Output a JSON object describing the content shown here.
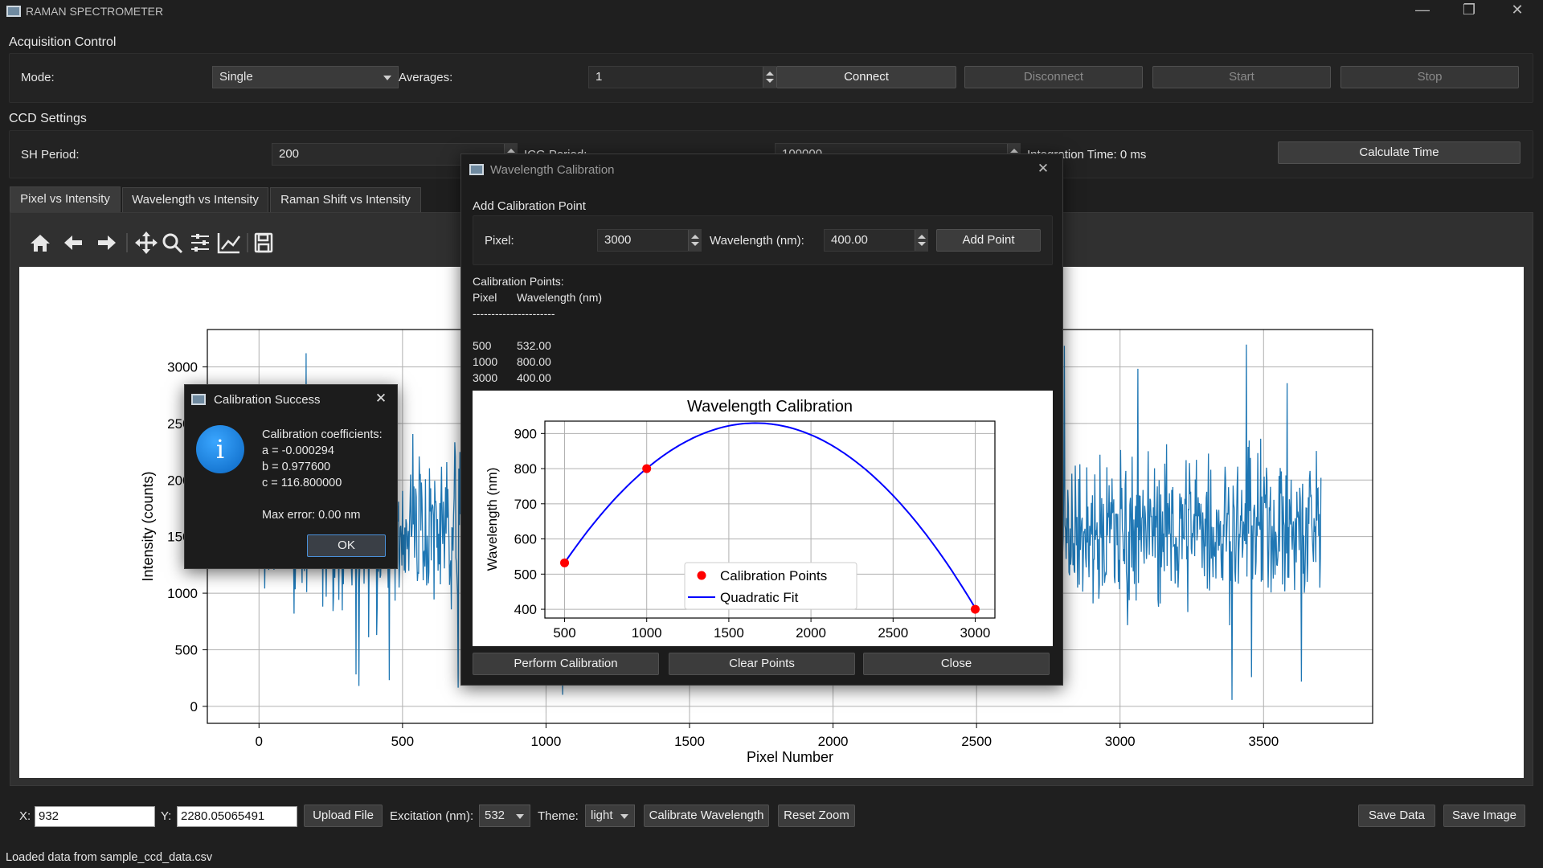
{
  "window": {
    "title": "RAMAN SPECTROMETER"
  },
  "acquisition": {
    "group_label": "Acquisition Control",
    "mode_label": "Mode:",
    "mode_value": "Single",
    "averages_label": "Averages:",
    "averages_value": "1",
    "connect": "Connect",
    "disconnect": "Disconnect",
    "start": "Start",
    "stop": "Stop"
  },
  "ccd": {
    "group_label": "CCD Settings",
    "sh_label": "SH Period:",
    "sh_value": "200",
    "icg_label": "ICG Period:",
    "icg_value": "100000",
    "integration": "Integration Time: 0 ms",
    "calc_button": "Calculate Time"
  },
  "tabs": [
    {
      "label": "Pixel vs Intensity",
      "active": true
    },
    {
      "label": "Wavelength vs Intensity",
      "active": false
    },
    {
      "label": "Raman Shift vs Intensity",
      "active": false
    }
  ],
  "toolbar": {
    "icons": [
      "home-icon",
      "back-arrow-icon",
      "forward-arrow-icon",
      "pan-icon",
      "zoom-icon",
      "subplots-config-icon",
      "axes-edit-icon",
      "save-icon"
    ]
  },
  "main_plot_labels": {
    "xlabel": "Pixel Number",
    "ylabel": "Intensity (counts)",
    "xticks": [
      "0",
      "500",
      "1000",
      "1500",
      "2000",
      "2500",
      "3000",
      "3500"
    ],
    "yticks": [
      "0",
      "500",
      "1000",
      "1500",
      "2000",
      "2500",
      "3000"
    ]
  },
  "calib_dialog": {
    "title": "Wavelength Calibration",
    "add_label": "Add Calibration Point",
    "pixel_label": "Pixel:",
    "pixel_value": "3000",
    "wl_label": "Wavelength (nm):",
    "wl_value": "400.00",
    "add_button": "Add Point",
    "points_header": "Calibration Points:",
    "col_pixel": "Pixel",
    "col_wavelength": "Wavelength (nm)",
    "separator": "----------------------",
    "rows": [
      {
        "pixel": "500",
        "wavelength": "532.00"
      },
      {
        "pixel": "1000",
        "wavelength": "800.00"
      },
      {
        "pixel": "3000",
        "wavelength": "400.00"
      }
    ],
    "perform": "Perform Calibration",
    "clear": "Clear Points",
    "close": "Close"
  },
  "success_dialog": {
    "title": "Calibration Success",
    "icon": "info-icon",
    "line1": "Calibration coefficients:",
    "line2": "a = -0.000294",
    "line3": "b = 0.977600",
    "line4": "c = 116.800000",
    "line5": "Max error: 0.00 nm",
    "ok": "OK"
  },
  "bottom": {
    "x_label": "X:",
    "x_value": "932",
    "y_label": "Y:",
    "y_value": "2280.05065491",
    "upload": "Upload File",
    "excitation_label": "Excitation (nm):",
    "excitation_value": "532",
    "theme_label": "Theme:",
    "theme_value": "light",
    "calibrate": "Calibrate Wavelength",
    "reset_zoom": "Reset Zoom",
    "save_data": "Save Data",
    "save_image": "Save Image"
  },
  "status": "Loaded data from sample_ccd_data.csv",
  "chart_data": [
    {
      "type": "line",
      "title": "",
      "xlabel": "Pixel Number",
      "ylabel": "Intensity (counts)",
      "xlim": [
        -180,
        3880
      ],
      "ylim": [
        -150,
        3330
      ],
      "grid": true,
      "series": [
        {
          "color": "#1f77b4",
          "description_samples": [
            [
              0,
              1500
            ],
            [
              10,
              100
            ],
            [
              100,
              2100
            ],
            [
              230,
              1250
            ],
            [
              400,
              1700
            ],
            [
              600,
              1300
            ],
            [
              800,
              1550
            ],
            [
              1000,
              1600
            ],
            [
              1200,
              1500
            ],
            [
              1500,
              1550
            ],
            [
              2000,
              1650
            ],
            [
              2500,
              1600
            ],
            [
              2650,
              100
            ],
            [
              2800,
              1700
            ],
            [
              3000,
              1650
            ],
            [
              3300,
              0
            ],
            [
              3500,
              1500
            ],
            [
              3700,
              1600
            ]
          ]
        }
      ]
    },
    {
      "type": "line",
      "title": "Wavelength Calibration",
      "xlabel": "",
      "ylabel": "Wavelength (nm)",
      "xlim": [
        380,
        3120
      ],
      "ylim": [
        375,
        935
      ],
      "xticks": [
        500,
        1000,
        1500,
        2000,
        2500,
        3000
      ],
      "yticks": [
        400,
        500,
        600,
        700,
        800,
        900
      ],
      "grid": true,
      "legend": "lower-center",
      "series": [
        {
          "name": "Calibration Points",
          "kind": "scatter",
          "color": "#ff0000",
          "x": [
            500,
            1000,
            3000
          ],
          "y": [
            532,
            800,
            400
          ]
        },
        {
          "name": "Quadratic Fit",
          "kind": "line",
          "color": "#0000ff",
          "coefficients": {
            "a": -0.000294,
            "b": 0.9776,
            "c": 116.8
          },
          "x_range": [
            500,
            3000
          ]
        }
      ]
    }
  ]
}
